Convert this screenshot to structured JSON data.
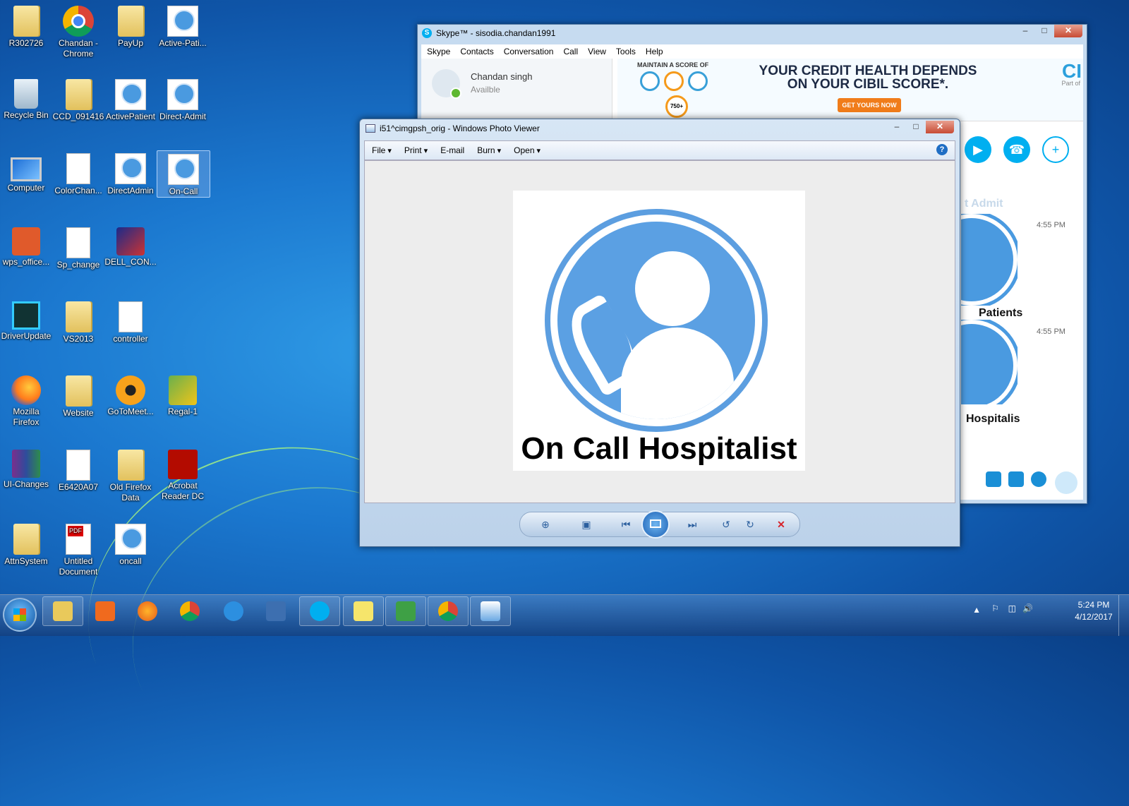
{
  "desktop": {
    "icons": [
      {
        "label": "R302726"
      },
      {
        "label": "Chandan - Chrome"
      },
      {
        "label": "PayUp"
      },
      {
        "label": "Active-Pati..."
      },
      {
        "label": "Recycle Bin"
      },
      {
        "label": "CCD_091416"
      },
      {
        "label": "ActivePatient"
      },
      {
        "label": "Direct-Admit"
      },
      {
        "label": "Computer"
      },
      {
        "label": "ColorChan..."
      },
      {
        "label": "DirectAdmin"
      },
      {
        "label": "On-Call"
      },
      {
        "label": "wps_office..."
      },
      {
        "label": "Sp_change"
      },
      {
        "label": "DELL_CON..."
      },
      {
        "label": "DriverUpdate"
      },
      {
        "label": "VS2013"
      },
      {
        "label": "controller"
      },
      {
        "label": "Mozilla Firefox"
      },
      {
        "label": "Website"
      },
      {
        "label": "GoToMeet..."
      },
      {
        "label": "Regal-1"
      },
      {
        "label": "UI-Changes"
      },
      {
        "label": "E6420A07"
      },
      {
        "label": "Old Firefox Data"
      },
      {
        "label": "Acrobat Reader DC"
      },
      {
        "label": "AttnSystem"
      },
      {
        "label": "Untitled Document"
      },
      {
        "label": "oncall"
      }
    ]
  },
  "skype": {
    "title": "Skype™ - sisodia.chandan1991",
    "menu": [
      "Skype",
      "Contacts",
      "Conversation",
      "Call",
      "View",
      "Tools",
      "Help"
    ],
    "profile_name": "Chandan singh",
    "profile_status": "Availble",
    "ad": {
      "tag": "MAINTAIN A SCORE OF",
      "score": "750+",
      "headline_1": "YOUR CREDIT HEALTH DEPENDS",
      "headline_2": "ON YOUR CIBIL SCORE*.",
      "cta": "GET YOURS NOW",
      "brand": "CI",
      "brand_sub": "Part of"
    },
    "chat": {
      "partial_title": "t Admit",
      "time_1": "4:55 PM",
      "time_2": "4:55 PM",
      "caption_1": "Patients",
      "caption_2": "Hospitalis"
    }
  },
  "photo_viewer": {
    "title": "i51^cimgpsh_orig - Windows Photo Viewer",
    "toolbar": [
      "File",
      "Print",
      "E-mail",
      "Burn",
      "Open"
    ],
    "image_caption": "On Call Hospitalist"
  },
  "taskbar": {
    "clock_time": "5:24 PM",
    "clock_date": "4/12/2017"
  }
}
